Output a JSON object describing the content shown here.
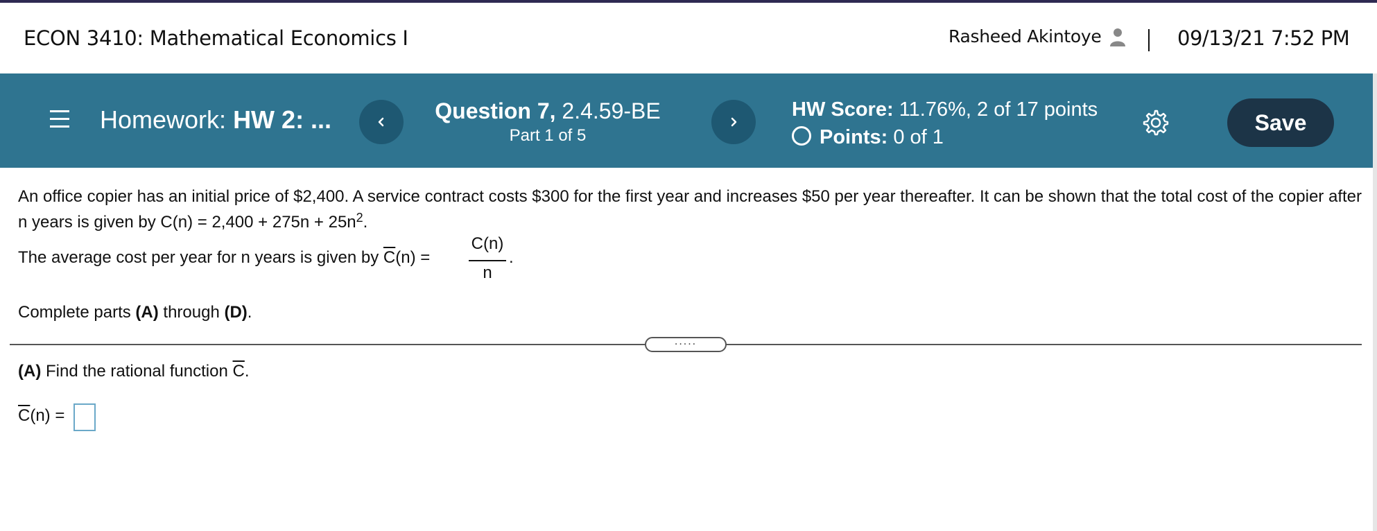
{
  "header": {
    "course_title": "ECON 3410: Mathematical Economics I",
    "user_name": "Rasheed Akintoye",
    "datetime": "09/13/21 7:52 PM"
  },
  "nav": {
    "homework_prefix": "Homework:",
    "homework_name": "HW 2: ...",
    "question_bold": "Question 7,",
    "question_code": "2.4.59-BE",
    "part_label": "Part 1 of 5",
    "hw_score_label": "HW Score:",
    "hw_score_value": "11.76%, 2 of 17 points",
    "points_label": "Points:",
    "points_value": "0 of 1",
    "save_label": "Save"
  },
  "problem": {
    "line1": "An office copier has an initial price of $2,400. A service contract costs $300 for the first year and increases $50 per year thereafter. It can be shown that the total cost of the copier after n years is given by C(n) = 2,400 + 275n + 25n",
    "line1_sup": "2",
    "line1_end": ".",
    "avg_text": "The average cost per year for n years is given by ",
    "avg_cbar": "C",
    "avg_after": "(n) =",
    "frac_num": "C(n)",
    "frac_den": "n",
    "frac_dot": ".",
    "complete_pre": "Complete parts ",
    "complete_a": "(A)",
    "complete_mid": " through ",
    "complete_d": "(D)",
    "complete_end": "."
  },
  "divider": {
    "handle_label": "....."
  },
  "partA": {
    "label": "(A)",
    "text": " Find the rational function ",
    "cbar": "C",
    "end": ".",
    "answer_cbar": "C",
    "answer_prefix": "(n) ="
  },
  "colors": {
    "nav_bg": "#2f7490",
    "nav_button": "#1e5872",
    "save_bg": "#1c3447",
    "answer_border": "#6aa8c8"
  }
}
